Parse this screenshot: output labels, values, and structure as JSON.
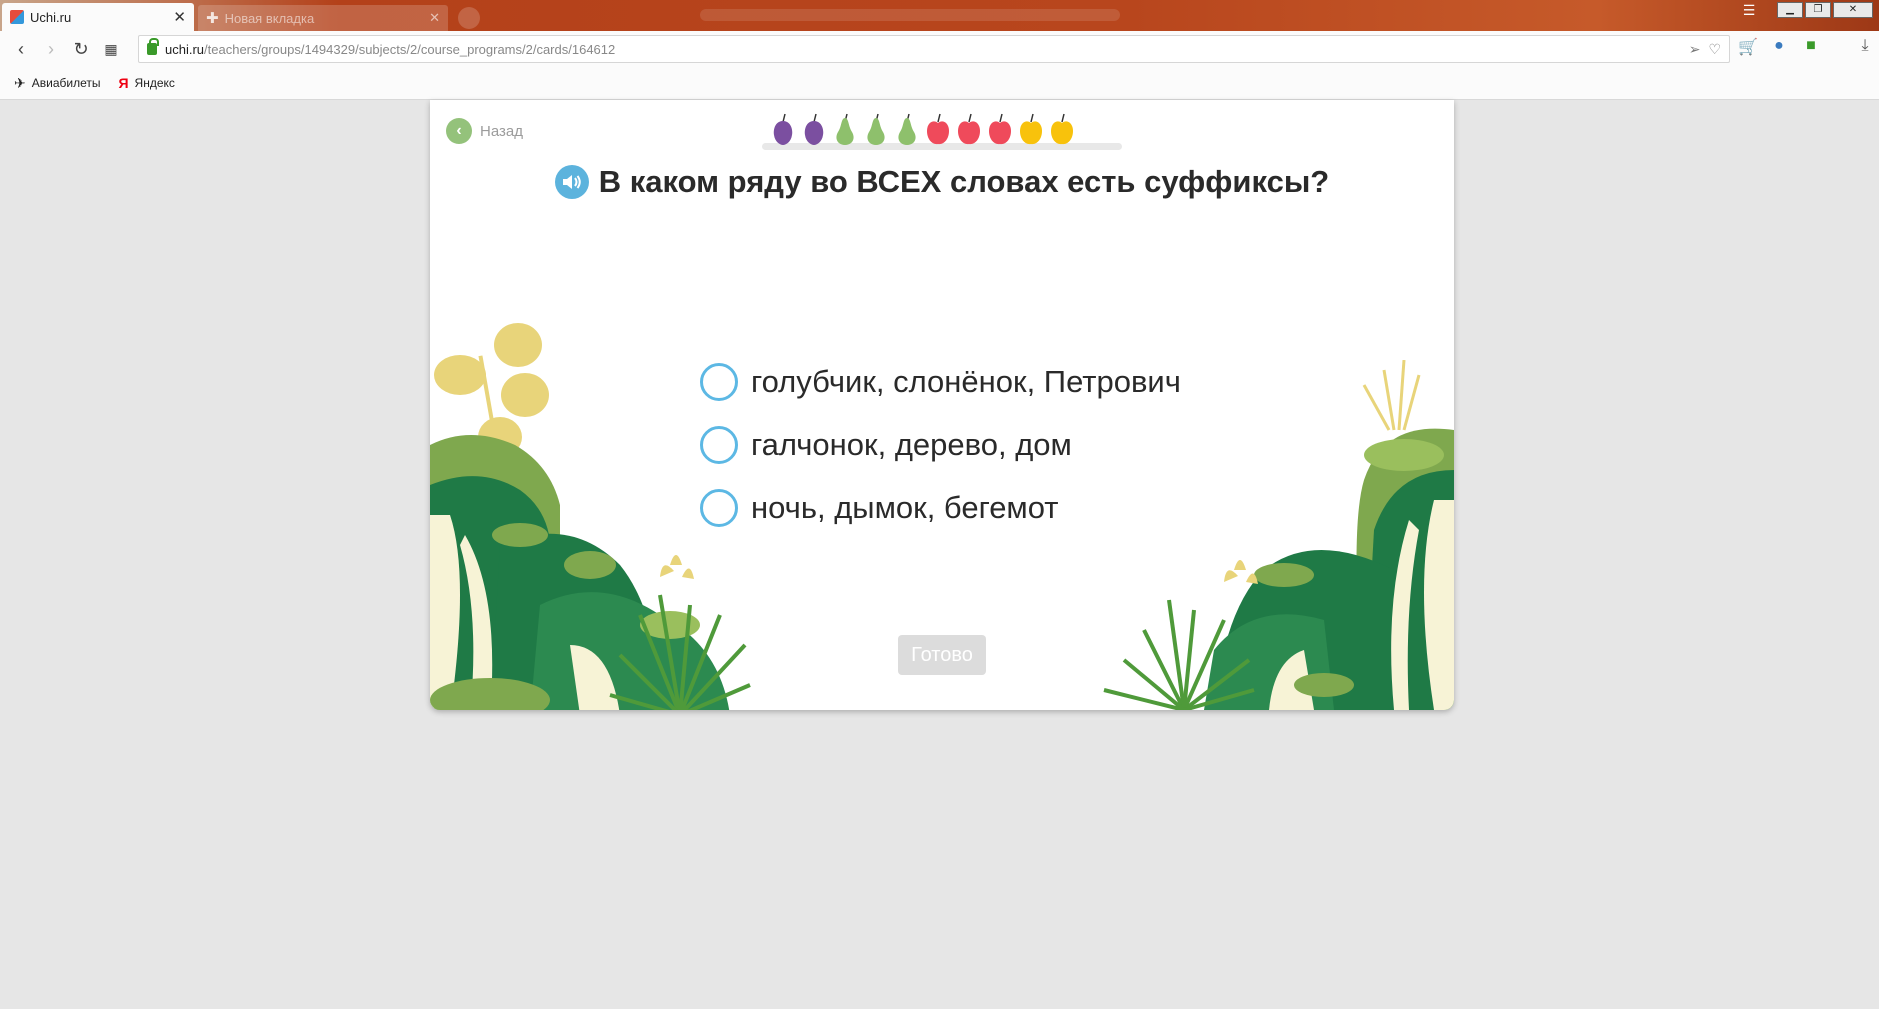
{
  "browser": {
    "tab_title": "Uchi.ru",
    "tab_close": "✕",
    "new_tab_label": "Новая вкладка",
    "url_host": "uchi.ru",
    "url_path": "/teachers/groups/1494329/subjects/2/course_programs/2/cards/164612",
    "bookmarks": [
      {
        "label": "Авиабилеты"
      },
      {
        "label": "Яндекс"
      }
    ]
  },
  "lesson": {
    "back_label": "Назад",
    "question": "В каком ряду во ВСЕХ словах есть суффиксы?",
    "options": [
      {
        "label": "голубчик, слонёнок, Петрович"
      },
      {
        "label": "галчонок, дерево, дом"
      },
      {
        "label": "ночь, дымок, бегемот"
      }
    ],
    "done_label": "Готово",
    "progress_fruits": [
      "plum",
      "plum",
      "pear",
      "pear",
      "pear",
      "apple",
      "apple",
      "apple",
      "lemon",
      "lemon"
    ],
    "colors": {
      "accent_blue": "#5cb8e4",
      "back_green": "#94c27b",
      "button_disabled": "#dcdcdc",
      "jungle_dark": "#1f7a46",
      "jungle_light": "#7fa84e",
      "plum": "#7b4fa0",
      "pear": "#8ec06c",
      "apple": "#ef4a5b",
      "lemon": "#f8c20c"
    }
  }
}
